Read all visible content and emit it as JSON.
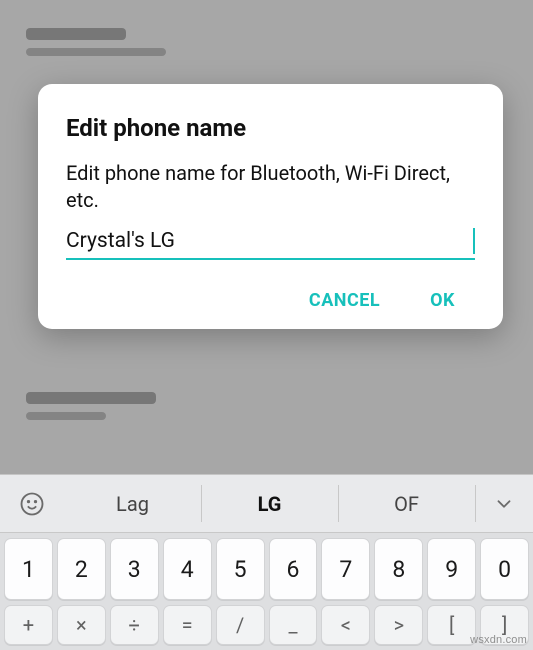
{
  "dialog": {
    "title": "Edit phone name",
    "description": "Edit phone name for Bluetooth, Wi-Fi Direct, etc.",
    "input_value": "Crystal's LG",
    "cancel_label": "CANCEL",
    "ok_label": "OK"
  },
  "keyboard": {
    "suggestions": [
      "Lag",
      "LG",
      "OF"
    ],
    "number_row": [
      "1",
      "2",
      "3",
      "4",
      "5",
      "6",
      "7",
      "8",
      "9",
      "0"
    ],
    "op_row": [
      "+",
      "×",
      "÷",
      "=",
      "/",
      "_",
      "<",
      ">",
      "[",
      "]"
    ]
  },
  "icons": {
    "emoji": "☺",
    "expand": "⌄"
  },
  "watermark": "wsxdn.com"
}
